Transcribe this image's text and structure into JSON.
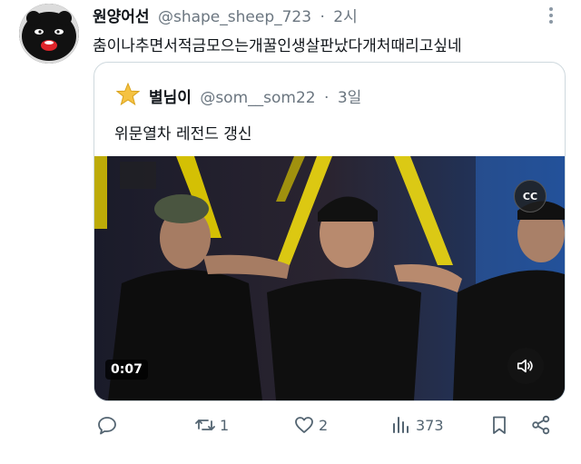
{
  "tweet": {
    "display_name": "원양어선",
    "handle": "@shape_sheep_723",
    "separator": "·",
    "time": "2시",
    "text": "춤이나추면서적금모으는개꿀인생살판났다개처때리고싶네"
  },
  "quoted_tweet": {
    "display_name": "별님이",
    "handle": "@som__som22",
    "separator": "·",
    "time": "3일",
    "text": "위문열차 레전드 갱신",
    "video": {
      "duration": "0:07",
      "cc_label": "CC"
    }
  },
  "actions": {
    "replies": "",
    "retweets": "1",
    "likes": "2",
    "views": "373"
  },
  "colors": {
    "text_primary": "#0f1419",
    "text_secondary": "#536471",
    "border": "#cfd9de"
  }
}
